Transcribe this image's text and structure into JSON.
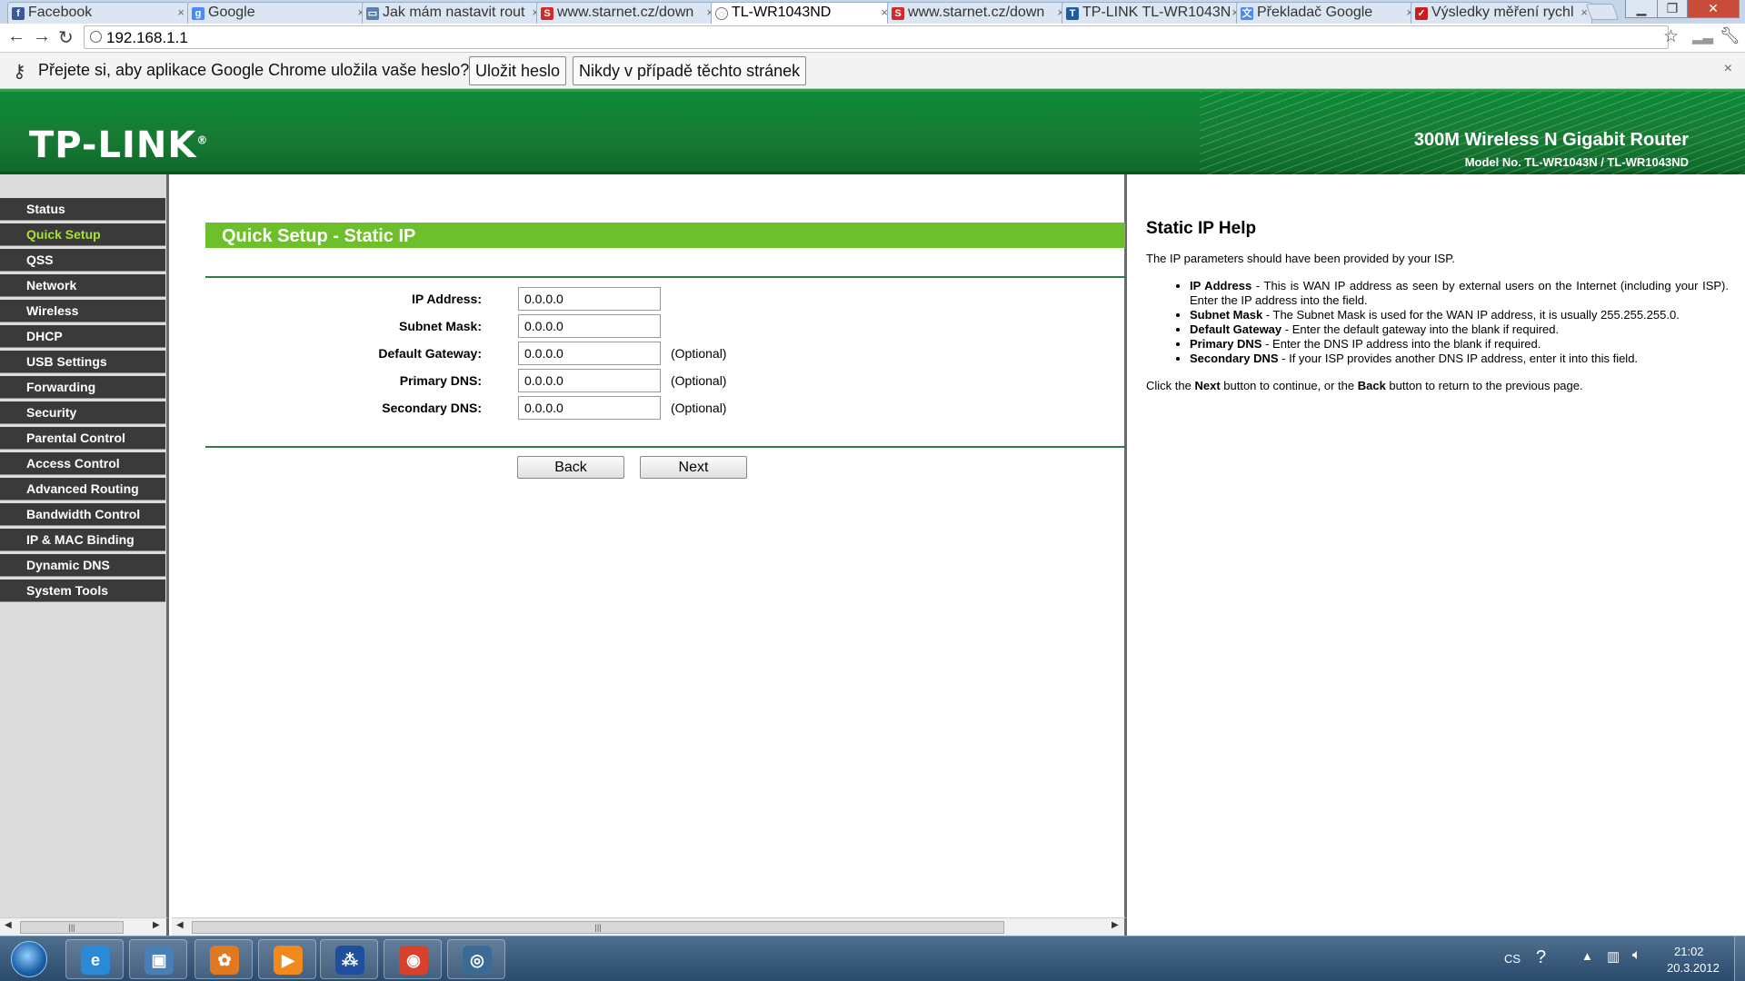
{
  "browser": {
    "tabs": [
      {
        "label": "Facebook",
        "icon": "facebook-icon",
        "color": "#3b5998",
        "glyph": "f"
      },
      {
        "label": "Google",
        "icon": "google-icon",
        "color": "#4a8af4",
        "glyph": "g"
      },
      {
        "label": "Jak mám nastavit rout",
        "icon": "page-icon",
        "color": "#5a7fa8",
        "glyph": "▭"
      },
      {
        "label": "www.starnet.cz/down",
        "icon": "starnet-icon",
        "color": "#d02a2a",
        "glyph": "S"
      },
      {
        "label": "TL-WR1043ND",
        "icon": "loading-icon",
        "color": "#777777",
        "glyph": "◌",
        "active": true
      },
      {
        "label": "www.starnet.cz/down",
        "icon": "starnet-icon",
        "color": "#d02a2a",
        "glyph": "S"
      },
      {
        "label": "TP-LINK TL-WR1043N",
        "icon": "tplink-icon",
        "color": "#1f5b9e",
        "glyph": "T"
      },
      {
        "label": "Překladač Google",
        "icon": "google-translate-icon",
        "color": "#4a8af4",
        "glyph": "文"
      },
      {
        "label": "Výsledky měření rychl",
        "icon": "speedtest-icon",
        "color": "#c81e1e",
        "glyph": "✓"
      }
    ],
    "url": "192.168.1.1",
    "window_controls": {
      "minimize": "▁",
      "maximize": "❐",
      "close": "✕"
    }
  },
  "infobar": {
    "message": "Přejete si, aby aplikace Google Chrome uložila vaše heslo?",
    "save_label": "Uložit heslo",
    "never_label": "Nikdy v případě těchto stránek",
    "close": "×"
  },
  "router": {
    "logo": "TP-LINK",
    "logo_mark": "®",
    "product_name": "300M Wireless N Gigabit Router",
    "model_no": "Model No. TL-WR1043N / TL-WR1043ND",
    "menu": [
      "Status",
      "Quick Setup",
      "QSS",
      "Network",
      "Wireless",
      "DHCP",
      "USB Settings",
      "Forwarding",
      "Security",
      "Parental Control",
      "Access Control",
      "Advanced Routing",
      "Bandwidth Control",
      "IP & MAC Binding",
      "Dynamic DNS",
      "System Tools"
    ],
    "active_menu": "Quick Setup",
    "page_title": "Quick Setup - Static IP",
    "fields": [
      {
        "label": "IP Address:",
        "value": "0.0.0.0",
        "note": ""
      },
      {
        "label": "Subnet Mask:",
        "value": "0.0.0.0",
        "note": ""
      },
      {
        "label": "Default Gateway:",
        "value": "0.0.0.0",
        "note": "(Optional)"
      },
      {
        "label": "Primary DNS:",
        "value": "0.0.0.0",
        "note": "(Optional)"
      },
      {
        "label": "Secondary DNS:",
        "value": "0.0.0.0",
        "note": "(Optional)"
      }
    ],
    "back_label": "Back",
    "next_label": "Next",
    "colors": {
      "header_green": "#177a33",
      "title_bar_green": "#6dbf2b",
      "active_menu": "#a8e23c"
    }
  },
  "help": {
    "title": "Static IP Help",
    "intro": "The IP parameters should have been provided by your ISP.",
    "items": [
      {
        "term": "IP Address",
        "text": " - This is WAN IP address as seen by external users on the Internet (including your ISP). Enter the IP address into the field."
      },
      {
        "term": "Subnet Mask",
        "text": " - The Subnet Mask is used for the WAN IP address, it is usually 255.255.255.0."
      },
      {
        "term": "Default Gateway",
        "text": " - Enter the default gateway into the blank if required."
      },
      {
        "term": "Primary DNS",
        "text": " - Enter the DNS IP address into the blank if required."
      },
      {
        "term": "Secondary DNS",
        "text": " - If your ISP provides another DNS IP address, enter it into this field."
      }
    ],
    "footer_pre": "Click the ",
    "footer_next": "Next",
    "footer_mid": " button to continue, or the ",
    "footer_back": "Back",
    "footer_post": " button to return to the previous page."
  },
  "taskbar": {
    "apps": [
      {
        "name": "internet-explorer-icon",
        "glyph": "e",
        "color": "#2a8ad8"
      },
      {
        "name": "photo-viewer-icon",
        "glyph": "▣",
        "color": "#4a7fb5"
      },
      {
        "name": "media-center-icon",
        "glyph": "✿",
        "color": "#e07a22"
      },
      {
        "name": "media-player-icon",
        "glyph": "▶",
        "color": "#f08a1c"
      },
      {
        "name": "network-app-icon",
        "glyph": "⁂",
        "color": "#1d4f9c"
      },
      {
        "name": "chrome-icon",
        "glyph": "◉",
        "color": "#d9412c"
      },
      {
        "name": "wifi-app-icon",
        "glyph": "◎",
        "color": "#3a6b94"
      }
    ],
    "lang": "CS",
    "time": "21:02",
    "date": "20.3.2012"
  }
}
